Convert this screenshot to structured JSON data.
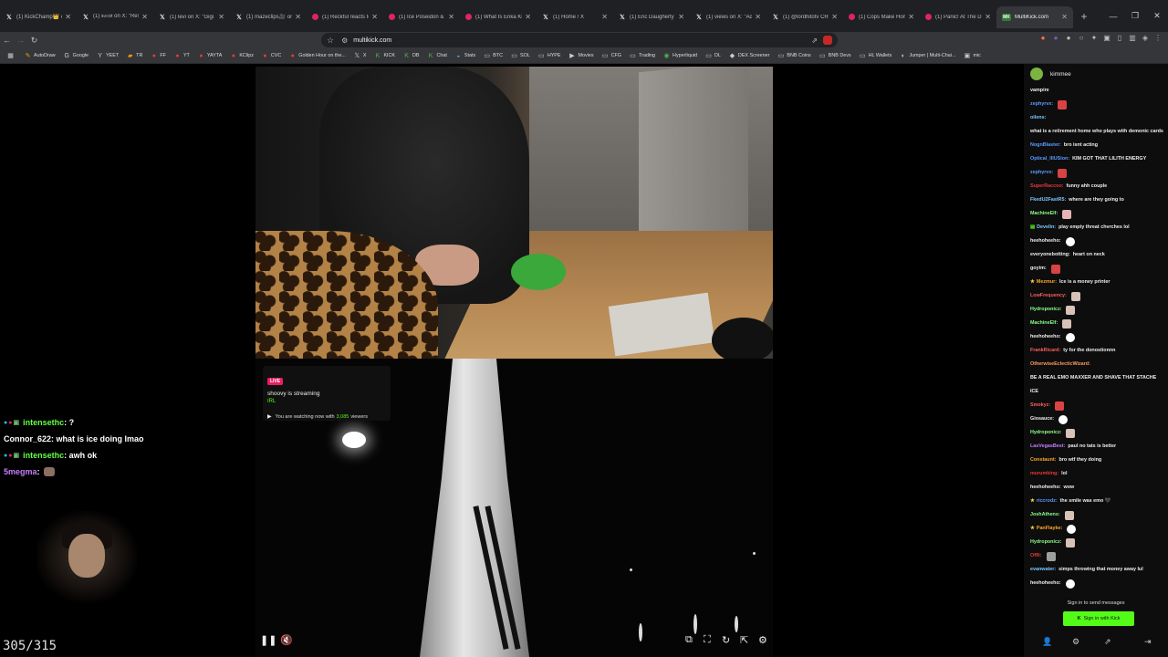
{
  "browser": {
    "tabs": [
      {
        "icon": "x-logo-icon",
        "title": "(1) KickChamp👑 on"
      },
      {
        "icon": "x-logo-icon",
        "title": "(1) 𝔰𝔲𝔢𝔵𝔞 on X: \"Resu"
      },
      {
        "icon": "x-logo-icon",
        "title": "(1) levi on X: \"Gigi dro"
      },
      {
        "icon": "x-logo-icon",
        "title": "(1) mazeclips🎥 on X"
      },
      {
        "icon": "youtube-icon",
        "title": "(1) Reckful reacts to c"
      },
      {
        "icon": "youtube-icon",
        "title": "(1) Ice Poseidon & Ni"
      },
      {
        "icon": "youtube-icon",
        "title": "(1) What Is Erika Kirk"
      },
      {
        "icon": "x-logo-icon",
        "title": "(1) Home / X"
      },
      {
        "icon": "x-logo-icon",
        "title": "(1) Eric Daugherty on"
      },
      {
        "icon": "x-logo-icon",
        "title": "(1) views on X: \"Adin"
      },
      {
        "icon": "x-logo-icon",
        "title": "(1) @lordhitotv CRAS"
      },
      {
        "icon": "youtube-icon",
        "title": "(1) Cops Make Homic"
      },
      {
        "icon": "youtube-icon",
        "title": "(1) Panic! At The Disc"
      },
      {
        "icon": "multikick-icon",
        "title": "MultiKick.com"
      }
    ],
    "active_tab_index": 13,
    "url": "multikick.com",
    "bookmarks": [
      {
        "icon": "autodraw-icon",
        "label": "AutoDraw"
      },
      {
        "icon": "google-icon",
        "label": "Google"
      },
      {
        "icon": "yeet-icon",
        "label": "YEET"
      },
      {
        "icon": "tr-icon",
        "label": "TR"
      },
      {
        "icon": "ff-icon",
        "label": "FF"
      },
      {
        "icon": "youtube-icon",
        "label": "YT"
      },
      {
        "icon": "youtube-icon",
        "label": "YAYTA"
      },
      {
        "icon": "youtube-icon",
        "label": "KClipz"
      },
      {
        "icon": "youtube-icon",
        "label": "CVC"
      },
      {
        "icon": "youtube-icon",
        "label": "Golden Hour on the..."
      },
      {
        "icon": "x-logo-icon",
        "label": "X"
      },
      {
        "icon": "kick-icon",
        "label": "KICK"
      },
      {
        "icon": "kick-icon",
        "label": "DB"
      },
      {
        "icon": "kick-icon",
        "label": "Chat"
      },
      {
        "icon": "stats-icon",
        "label": "Stats"
      },
      {
        "icon": "folder-icon",
        "label": "BTC"
      },
      {
        "icon": "folder-icon",
        "label": "SOL"
      },
      {
        "icon": "folder-icon",
        "label": "HYPE"
      },
      {
        "icon": "play-icon",
        "label": "Movies"
      },
      {
        "icon": "folder-icon",
        "label": "CFG"
      },
      {
        "icon": "folder-icon",
        "label": "Trading"
      },
      {
        "icon": "hyperliquid-icon",
        "label": "Hyperliquid"
      },
      {
        "icon": "folder-icon",
        "label": "DL"
      },
      {
        "icon": "dex-icon",
        "label": "DEX Screener"
      },
      {
        "icon": "folder-icon",
        "label": "BNB Coins"
      },
      {
        "icon": "folder-icon",
        "label": "BNB Devs"
      },
      {
        "icon": "folder-icon",
        "label": "HL Wallets"
      },
      {
        "icon": "jumper-icon",
        "label": "Jumper | Multi-Chai..."
      },
      {
        "icon": "mic-icon",
        "label": "mic"
      }
    ]
  },
  "stream_card": {
    "badge": "LIVE",
    "title": "shoovy is streaming",
    "category": "IRL",
    "viewers_prefix": "You are watching now with",
    "viewers": "3,085",
    "viewers_suffix": "viewers"
  },
  "overlay_chat": [
    {
      "user": "intensethc",
      "text": " : ?",
      "color": "green",
      "badges": true,
      "emote": false
    },
    {
      "user": "Connor_622",
      "text": " : what is ice doing lmao",
      "color": "white",
      "badges": false,
      "emote": false
    },
    {
      "user": "intensethc",
      "text": " : awh ok",
      "color": "green",
      "badges": true,
      "emote": false
    },
    {
      "user": "5megma",
      "text": " :",
      "color": "purple",
      "badges": false,
      "emote": true
    }
  ],
  "counter": "305/315",
  "chat_panel": {
    "channel": "kimmee",
    "sign_in_text": "Sign in to send messages",
    "sign_in_button": "Sign in with Kick",
    "messages": [
      {
        "user": "",
        "text": "vampire",
        "color": "#eeeeee",
        "emote": ""
      },
      {
        "user": "zephyrvx:",
        "text": "",
        "color": "#5b9bff",
        "emote": "red"
      },
      {
        "user": "oilens:",
        "text": "what is a retirement home who plays with demonic cards",
        "color": "#7ec8ff",
        "emote": ""
      },
      {
        "user": "NognBlaster:",
        "text": "bro isnt acting",
        "color": "#5b9bff",
        "emote": ""
      },
      {
        "user": "Optical_lllUSion:",
        "text": "KIM GOT THAT LILITH ENERGY",
        "color": "#5b9bff",
        "emote": ""
      },
      {
        "user": "zephyrvx:",
        "text": "",
        "color": "#5b9bff",
        "emote": "red"
      },
      {
        "user": "SuperRaccoo:",
        "text": "funny ahh couple",
        "color": "#e53935",
        "emote": ""
      },
      {
        "user": "FkedU2FastR5:",
        "text": "where are they going to",
        "color": "#7ec8ff",
        "emote": ""
      },
      {
        "user": "MachineElf:",
        "text": "",
        "color": "#8bff8b",
        "emote": "pink"
      },
      {
        "user": "Develin:",
        "text": "play empty threat chvrches lol",
        "color": "#7ec8ff",
        "emote": "",
        "prefix": "▤"
      },
      {
        "user": "heehoheeho:",
        "text": "",
        "color": "#eeeeee",
        "emote": "white"
      },
      {
        "user": "everyonebotting:",
        "text": "heart on neck",
        "color": "#eeeeee",
        "emote": ""
      },
      {
        "user": "goyim:",
        "text": "",
        "color": "#eeeeee",
        "emote": "red"
      },
      {
        "user": "Mezmur:",
        "text": "Ice is a money printer",
        "color": "#ffa726",
        "emote": "",
        "star": true
      },
      {
        "user": "LowFrequency:",
        "text": "",
        "color": "#ff5e5e",
        "emote": "face"
      },
      {
        "user": "Hydroponicz:",
        "text": "",
        "color": "#8bff8b",
        "emote": "face"
      },
      {
        "user": "MachineElf:",
        "text": "",
        "color": "#8bff8b",
        "emote": "face"
      },
      {
        "user": "heehoheeho:",
        "text": "",
        "color": "#eeeeee",
        "emote": "white"
      },
      {
        "user": "FrankRicard:",
        "text": "ty for the donostionnn",
        "color": "#ff5e5e",
        "emote": ""
      },
      {
        "user": "OtherwiseEclecticWizard:",
        "text": "BE A REAL EMO MAXXER AND SHAVE THAT STACHE ICE",
        "color": "#ff9b5e",
        "emote": ""
      },
      {
        "user": "Smokyz:",
        "text": "",
        "color": "#ff5e5e",
        "emote": "red"
      },
      {
        "user": "Giosauce:",
        "text": "",
        "color": "#eeeeee",
        "emote": "white"
      },
      {
        "user": "Hydroponicz:",
        "text": "",
        "color": "#8bff8b",
        "emote": "face"
      },
      {
        "user": "LasVegasBest:",
        "text": "paul no tats is better",
        "color": "#c77dff",
        "emote": ""
      },
      {
        "user": "Constaunt:",
        "text": "bro wtf they doing",
        "color": "#ffa726",
        "emote": ""
      },
      {
        "user": "murumking:",
        "text": "lol",
        "color": "#e53935",
        "emote": ""
      },
      {
        "user": "heehoheeho:",
        "text": "wow",
        "color": "#eeeeee",
        "emote": ""
      },
      {
        "user": "riccrodz:",
        "text": "the smile was emo 🖤",
        "color": "#5b9bff",
        "emote": "",
        "star": true
      },
      {
        "user": "JoshAthens:",
        "text": "",
        "color": "#8bff8b",
        "emote": "face"
      },
      {
        "user": "PanFlayke:",
        "text": "",
        "color": "#ffa726",
        "emote": "white",
        "star": true
      },
      {
        "user": "Hydroponicz:",
        "text": "",
        "color": "#8bff8b",
        "emote": "face"
      },
      {
        "user": "Offli:",
        "text": "",
        "color": "#e53935",
        "emote": "grid"
      },
      {
        "user": "evanwater:",
        "text": "simps throwing that money away lul",
        "color": "#7ec8ff",
        "emote": ""
      },
      {
        "user": "heehoheeho:",
        "text": "",
        "color": "#eeeeee",
        "emote": "white"
      }
    ]
  },
  "colors": {
    "kick_green": "#53fc18",
    "live_red": "#e91e63",
    "chrome_dark": "#1f2023",
    "chrome_mid": "#35363a"
  }
}
